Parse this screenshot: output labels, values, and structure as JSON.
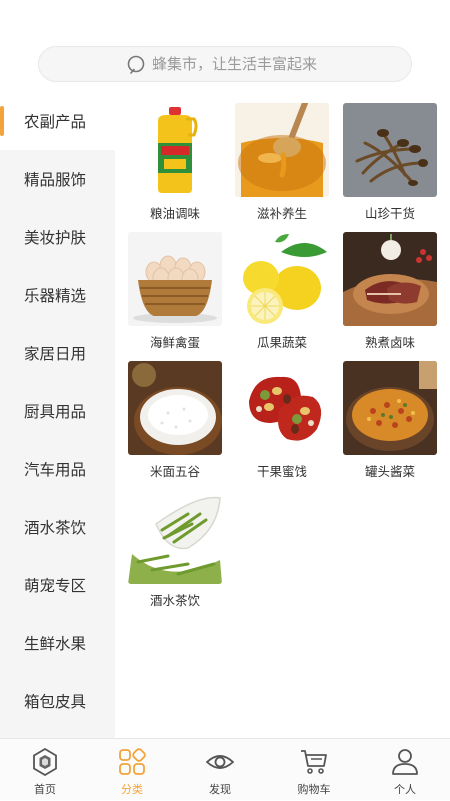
{
  "search": {
    "placeholder": "蜂集市，让生活丰富起来",
    "icon": "search-icon"
  },
  "sidebar": {
    "items": [
      {
        "label": "农副产品",
        "active": true
      },
      {
        "label": "精品服饰"
      },
      {
        "label": "美妆护肤"
      },
      {
        "label": "乐器精选"
      },
      {
        "label": "家居日用"
      },
      {
        "label": "厨具用品"
      },
      {
        "label": "汽车用品"
      },
      {
        "label": "酒水茶饮"
      },
      {
        "label": "萌宠专区"
      },
      {
        "label": "生鲜水果"
      },
      {
        "label": "箱包皮具"
      }
    ],
    "accent": "#f2a33a"
  },
  "categories": [
    {
      "label": "粮油调味",
      "image": "cooking-oil-bottle"
    },
    {
      "label": "滋补养生",
      "image": "honey-dipper"
    },
    {
      "label": "山珍干货",
      "image": "dried-mushrooms"
    },
    {
      "label": "海鲜禽蛋",
      "image": "egg-basket"
    },
    {
      "label": "瓜果蔬菜",
      "image": "lemons"
    },
    {
      "label": "熟煮卤味",
      "image": "cured-meat"
    },
    {
      "label": "米面五谷",
      "image": "rice-bowl"
    },
    {
      "label": "干果蜜饯",
      "image": "dried-fruit"
    },
    {
      "label": "罐头酱菜",
      "image": "pickled-vegetables"
    },
    {
      "label": "酒水茶饮",
      "image": "green-tea-leaves"
    }
  ],
  "tabbar": {
    "items": [
      {
        "label": "首页",
        "icon": "home-hexagon-icon"
      },
      {
        "label": "分类",
        "icon": "grid-category-icon",
        "active": true
      },
      {
        "label": "发现",
        "icon": "eye-icon"
      },
      {
        "label": "购物车",
        "icon": "cart-icon"
      },
      {
        "label": "个人",
        "icon": "person-icon"
      }
    ],
    "active_color": "#f2a33a",
    "inactive_color": "#555555"
  }
}
